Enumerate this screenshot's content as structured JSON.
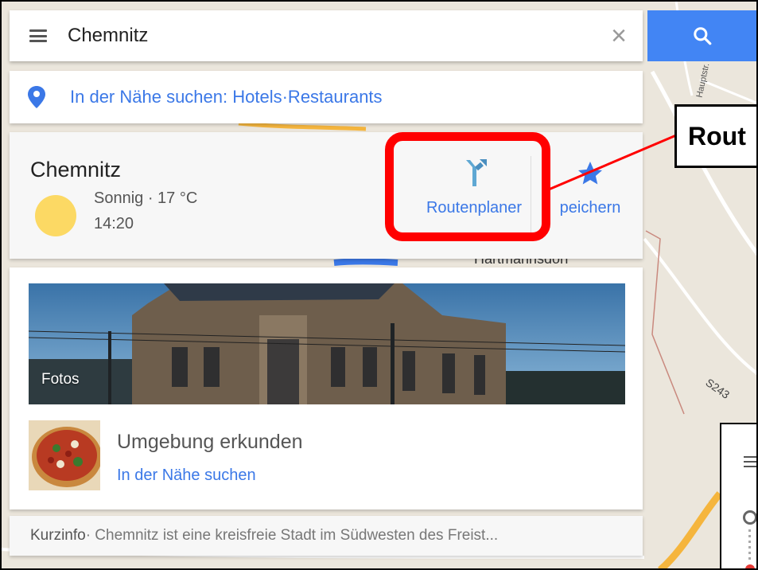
{
  "search": {
    "value": "Chemnitz",
    "clear_symbol": "×"
  },
  "nearby": {
    "text": "In der Nähe suchen: Hotels·Restaurants"
  },
  "place": {
    "name": "Chemnitz",
    "weather": "Sonnig · 17 °C",
    "time": "14:20",
    "route_label": "Routenplaner",
    "save_label": "peichern"
  },
  "callout": {
    "text": "Rout"
  },
  "photos": {
    "label": "Fotos"
  },
  "explore": {
    "title": "Umgebung erkunden",
    "link": "In der Nähe suchen"
  },
  "short_info": {
    "label": "Kurzinfo",
    "text": " · Chemnitz ist eine kreisfreie Stadt im Südwesten des Freist..."
  },
  "map": {
    "place_label": "Hartmannsdorf",
    "road_label": "S243",
    "street_label": "Hauptstr."
  },
  "colors": {
    "accent_blue": "#4285f4",
    "link_blue": "#3b78e7",
    "highlight_red": "#ff0000",
    "sun_yellow": "#fcd964"
  }
}
